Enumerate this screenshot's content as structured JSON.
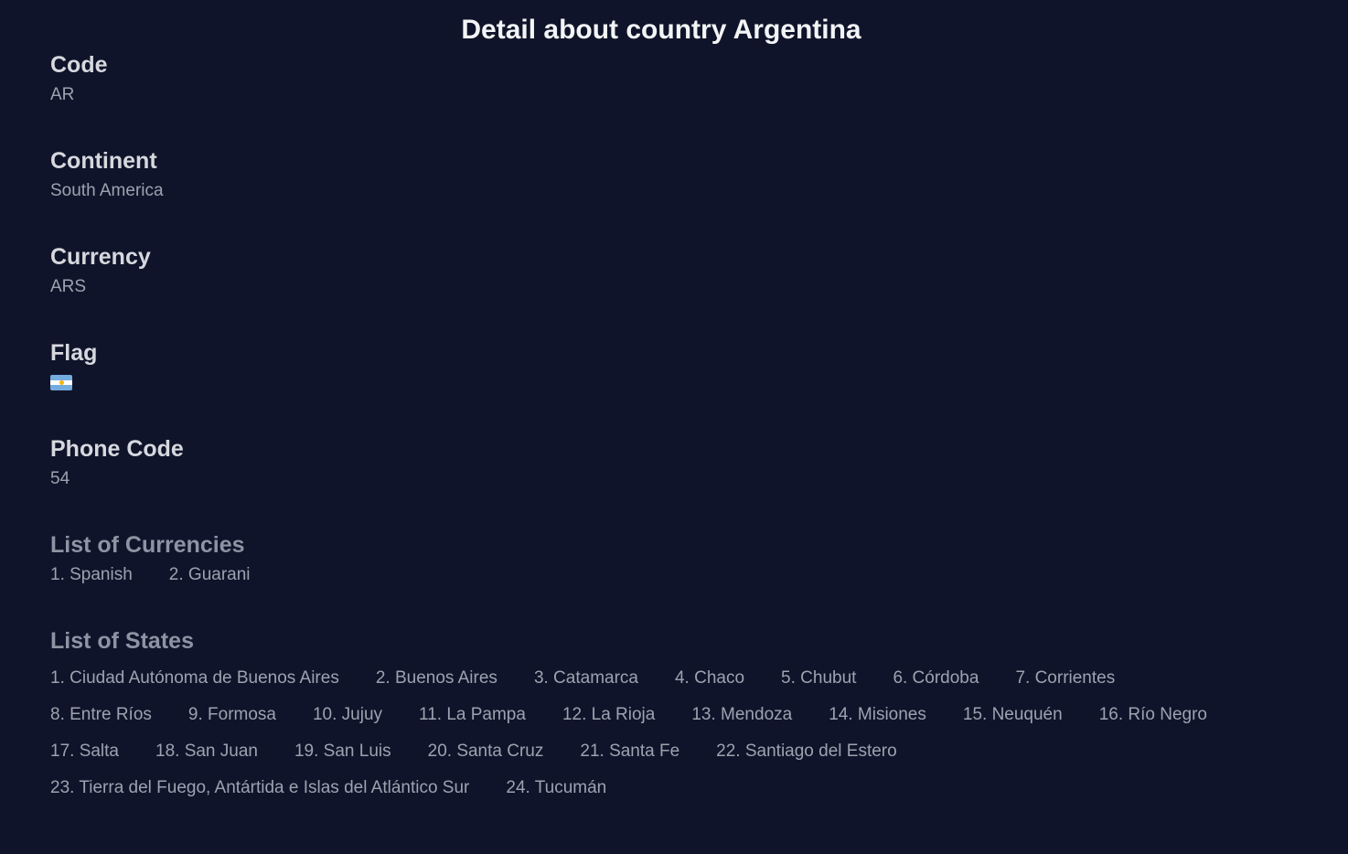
{
  "page_title": "Detail about country Argentina",
  "fields": [
    {
      "label": "Code",
      "value": "AR"
    },
    {
      "label": "Continent",
      "value": "South America"
    },
    {
      "label": "Currency",
      "value": "ARS"
    },
    {
      "label": "Flag",
      "value": "🇦🇷"
    },
    {
      "label": "Phone Code",
      "value": "54"
    }
  ],
  "currencies": {
    "heading": "List of Currencies",
    "items": [
      "1. Spanish",
      "2. Guarani"
    ]
  },
  "states": {
    "heading": "List of States",
    "items": [
      "1. Ciudad Autónoma de Buenos Aires",
      "2. Buenos Aires",
      "3. Catamarca",
      "4. Chaco",
      "5. Chubut",
      "6. Córdoba",
      "7. Corrientes",
      "8. Entre Ríos",
      "9. Formosa",
      "10. Jujuy",
      "11. La Pampa",
      "12. La Rioja",
      "13. Mendoza",
      "14. Misiones",
      "15. Neuquén",
      "16. Río Negro",
      "17. Salta",
      "18. San Juan",
      "19. San Luis",
      "20. Santa Cruz",
      "21. Santa Fe",
      "22. Santiago del Estero",
      "23. Tierra del Fuego, Antártida e Islas del Atlántico Sur",
      "24. Tucumán"
    ]
  }
}
